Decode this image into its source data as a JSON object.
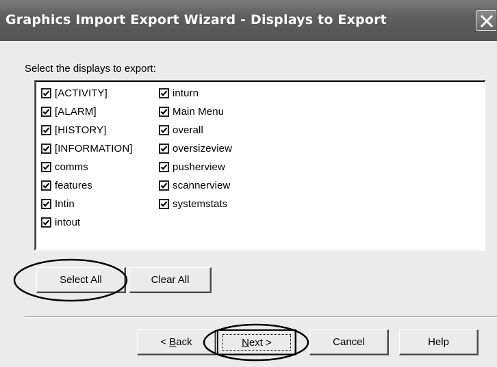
{
  "window": {
    "title": "Graphics Import Export Wizard - Displays to Export",
    "close_icon": "close-icon"
  },
  "instruction": "Select the displays to export:",
  "displays": {
    "column1": [
      {
        "label": "[ACTIVITY]",
        "checked": true
      },
      {
        "label": "[ALARM]",
        "checked": true
      },
      {
        "label": "[HISTORY]",
        "checked": true
      },
      {
        "label": "[INFORMATION]",
        "checked": true
      },
      {
        "label": "comms",
        "checked": true
      },
      {
        "label": "features",
        "checked": true
      },
      {
        "label": "Intin",
        "checked": true
      },
      {
        "label": "intout",
        "checked": true
      }
    ],
    "column2": [
      {
        "label": "inturn",
        "checked": true
      },
      {
        "label": "Main Menu",
        "checked": true
      },
      {
        "label": "overall",
        "checked": true
      },
      {
        "label": "oversizeview",
        "checked": true
      },
      {
        "label": "pusherview",
        "checked": true
      },
      {
        "label": "scannerview",
        "checked": true
      },
      {
        "label": "systemstats",
        "checked": true
      }
    ]
  },
  "buttons": {
    "select_all": "Select All",
    "clear_all": "Clear All",
    "back_prefix": "< ",
    "back_mnemonic": "B",
    "back_rest": "ack",
    "next_mnemonic": "N",
    "next_rest": "ext >",
    "cancel": "Cancel",
    "help": "Help"
  },
  "annotations": {
    "highlighted": [
      "Select All",
      "Next >"
    ],
    "color": "#000000"
  }
}
